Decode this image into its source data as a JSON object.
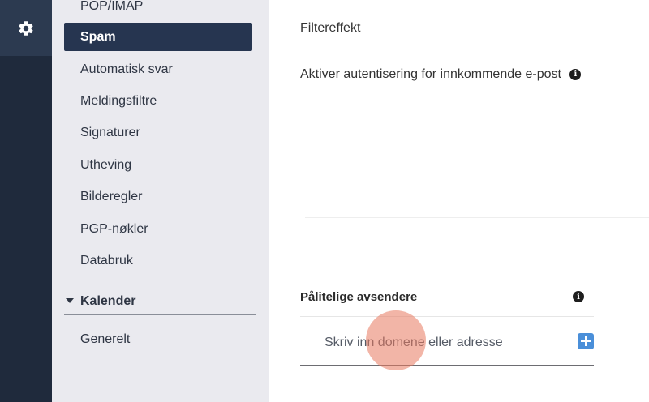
{
  "rail": {
    "settings_icon": "gear-icon"
  },
  "sidebar": {
    "items": [
      {
        "label": "POP/IMAP",
        "active": false
      },
      {
        "label": "Spam",
        "active": true
      },
      {
        "label": "Automatisk svar",
        "active": false
      },
      {
        "label": "Meldingsfiltre",
        "active": false
      },
      {
        "label": "Signaturer",
        "active": false
      },
      {
        "label": "Utheving",
        "active": false
      },
      {
        "label": "Bilderegler",
        "active": false
      },
      {
        "label": "PGP-nøkler",
        "active": false
      },
      {
        "label": "Databruk",
        "active": false
      }
    ],
    "section": {
      "label": "Kalender",
      "icon": "caret-down-icon"
    },
    "section_items": [
      {
        "label": "Generelt"
      }
    ]
  },
  "main": {
    "filter_effect_label": "Filtereffekt",
    "auth_label": "Aktiver autentisering for innkommende e-post",
    "trusted": {
      "title": "Pålitelige avsendere",
      "input_placeholder": "Skriv inn domene eller adresse",
      "add_icon": "plus-icon"
    }
  },
  "colors": {
    "rail_bg": "#1f2a3c",
    "sidebar_bg": "#eaeaef",
    "active_bg": "#263550",
    "add_button": "#4a8fd9"
  }
}
